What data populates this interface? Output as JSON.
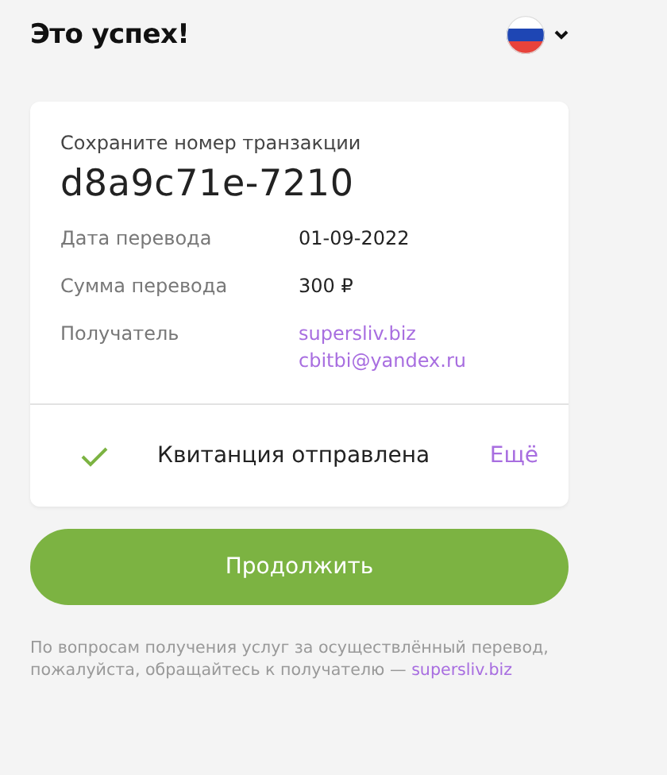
{
  "header": {
    "title": "Это успех!"
  },
  "receipt": {
    "caption": "Сохраните номер транзакции",
    "transaction_id": "d8a9c71e-7210",
    "rows": [
      {
        "label": "Дата перевода",
        "kind": "plain",
        "values": [
          "01-09-2022"
        ]
      },
      {
        "label": "Сумма перевода",
        "kind": "plain",
        "values": [
          "300 ₽"
        ]
      },
      {
        "label": "Получатель",
        "kind": "link",
        "values": [
          "supersliv.biz",
          "cbitbi@yandex.ru"
        ]
      }
    ],
    "status": {
      "text": "Квитанция отправлена",
      "more": "Ещё"
    }
  },
  "continue_button": "Продолжить",
  "footer": {
    "text": "По вопросам получения услуг за осуществлённый перевод, пожалуйста, обращайтесь к получателю — ",
    "link": "supersliv.biz"
  }
}
